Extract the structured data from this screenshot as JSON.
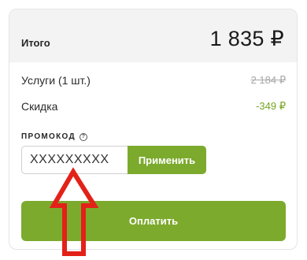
{
  "summary": {
    "total_label": "Итого",
    "total_value": "1 835 ₽"
  },
  "rows": {
    "services_label": "Услуги (1 шт.)",
    "services_old_price": "2 184 ₽",
    "discount_label": "Скидка",
    "discount_value": "-349 ₽"
  },
  "promo": {
    "label": "ПРОМОКОД",
    "help_icon": "question-circle-icon",
    "input_value": "XXXXXXXXX",
    "apply_label": "Применить"
  },
  "pay": {
    "label": "Оплатить"
  },
  "colors": {
    "accent_green": "#7caa2d",
    "discount_green": "#77a521",
    "annotation_red": "#e32119"
  },
  "annotation": {
    "icon": "up-arrow-icon"
  }
}
